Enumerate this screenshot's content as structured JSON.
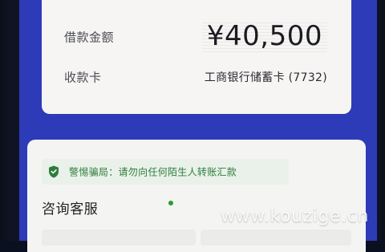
{
  "loan": {
    "amount_label": "借款金额",
    "amount_value": "¥40,500",
    "account_label": "收款卡",
    "account_value": "工商银行储蓄卡 (7732)"
  },
  "warning": {
    "icon": "shield-icon",
    "text": "警惕骗局：请勿向任何陌生人转账汇款",
    "color": "#2f7c3a"
  },
  "service": {
    "title": "咨询客服"
  },
  "watermark": {
    "text": "www.kouzige.cn"
  },
  "colors": {
    "screen_background": "#2d3bb8",
    "card_background": "#f6f5f3"
  }
}
